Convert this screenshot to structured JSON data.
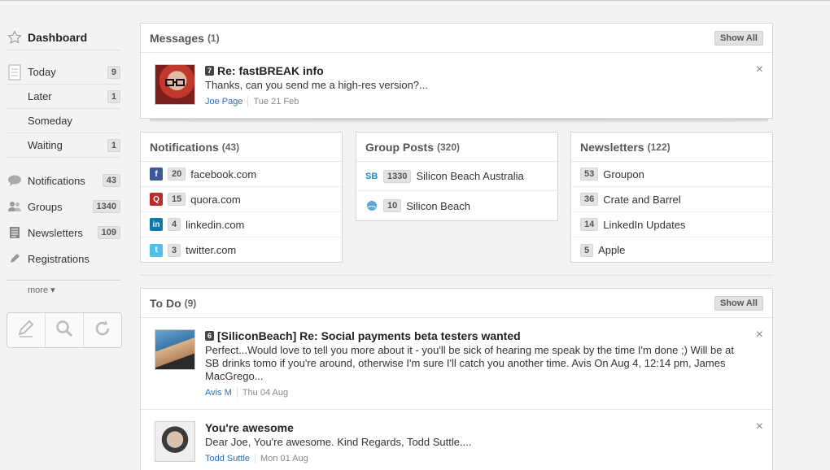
{
  "sidebar": {
    "dashboard": "Dashboard",
    "today": {
      "label": "Today",
      "count": "9"
    },
    "later": {
      "label": "Later",
      "count": "1"
    },
    "someday": {
      "label": "Someday"
    },
    "waiting": {
      "label": "Waiting",
      "count": "1"
    },
    "notifications": {
      "label": "Notifications",
      "count": "43"
    },
    "groups": {
      "label": "Groups",
      "count": "1340"
    },
    "newsletters": {
      "label": "Newsletters",
      "count": "109"
    },
    "registrations": {
      "label": "Registrations"
    },
    "more": "more"
  },
  "messages": {
    "title": "Messages",
    "count": "(1)",
    "show_all": "Show All",
    "item": {
      "tag": "7",
      "subject": "Re: fastBREAK info",
      "text": "Thanks, can you send me a high-res version?...",
      "from": "Joe Page",
      "date": "Tue 21 Feb"
    }
  },
  "notifications": {
    "title": "Notifications",
    "count": "(43)",
    "items": [
      {
        "count": "20",
        "label": "facebook.com"
      },
      {
        "count": "15",
        "label": "quora.com"
      },
      {
        "count": "4",
        "label": "linkedin.com"
      },
      {
        "count": "3",
        "label": "twitter.com"
      }
    ]
  },
  "group_posts": {
    "title": "Group Posts",
    "count": "(320)",
    "items": [
      {
        "icon_text": "SB",
        "count": "1330",
        "label": "Silicon Beach Australia"
      },
      {
        "count": "10",
        "label": "Silicon Beach"
      }
    ]
  },
  "newsletters": {
    "title": "Newsletters",
    "count": "(122)",
    "items": [
      {
        "count": "53",
        "label": "Groupon"
      },
      {
        "count": "36",
        "label": "Crate and Barrel"
      },
      {
        "count": "14",
        "label": "LinkedIn Updates"
      },
      {
        "count": "5",
        "label": "Apple"
      }
    ]
  },
  "todo": {
    "title": "To Do",
    "count": "(9)",
    "show_all": "Show All",
    "items": [
      {
        "tag": "6",
        "subject": "[SiliconBeach] Re: Social payments beta testers wanted",
        "text": "Perfect...Would love to tell you more about it - you'll be sick of hearing me speak by the time I'm done ;) Will be at SB drinks tomo if you're around, otherwise I'm sure I'll catch you another time. Avis On Aug 4, 12:14 pm, James MacGrego...",
        "from": "Avis M",
        "date": "Thu 04 Aug"
      },
      {
        "subject": "You're awesome",
        "text": "Dear Joe, You're awesome. Kind Regards, Todd Suttle....",
        "from": "Todd Suttle",
        "date": "Mon 01 Aug"
      }
    ]
  },
  "colors": {
    "facebook": "#3b5998",
    "quora": "#b92b27",
    "linkedin": "#0e76a8",
    "twitter": "#4fc1e9",
    "link": "#2a6ebb"
  },
  "icons": {
    "close": "×"
  }
}
